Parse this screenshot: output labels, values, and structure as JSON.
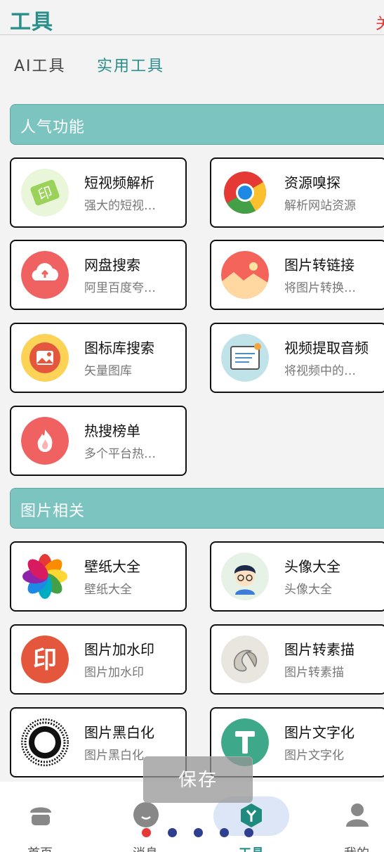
{
  "header": {
    "title": "工具",
    "right_text": "关"
  },
  "tabs": [
    {
      "label": "AI工具"
    },
    {
      "label": "实用工具"
    }
  ],
  "sections": [
    {
      "title": "人气功能",
      "items": [
        {
          "title": "短视频解析",
          "subtitle": "强大的短视…",
          "icon": "video-parse-icon"
        },
        {
          "title": "资源嗅探",
          "subtitle": "解析网站资源",
          "icon": "chrome-icon"
        },
        {
          "title": "网盘搜索",
          "subtitle": "阿里百度夸…",
          "icon": "cloud-upload-icon"
        },
        {
          "title": "图片转链接",
          "subtitle": "将图片转换…",
          "icon": "landscape-icon"
        },
        {
          "title": "图标库搜索",
          "subtitle": "矢量图库",
          "icon": "image-library-icon"
        },
        {
          "title": "视频提取音频",
          "subtitle": "将视频中的…",
          "icon": "video-audio-icon"
        },
        {
          "title": "热搜榜单",
          "subtitle": "多个平台热…",
          "icon": "flame-icon"
        }
      ]
    },
    {
      "title": "图片相关",
      "items": [
        {
          "title": "壁纸大全",
          "subtitle": "壁纸大全",
          "icon": "flower-icon"
        },
        {
          "title": "头像大全",
          "subtitle": "头像大全",
          "icon": "avatar-boy-icon"
        },
        {
          "title": "图片加水印",
          "subtitle": "图片加水印",
          "icon": "stamp-icon"
        },
        {
          "title": "图片转素描",
          "subtitle": "图片转素描",
          "icon": "sketch-icon"
        },
        {
          "title": "图片黑白化",
          "subtitle": "图片黑白化",
          "icon": "halftone-circle-icon"
        },
        {
          "title": "图片文字化",
          "subtitle": "图片文字化",
          "icon": "text-t-icon"
        }
      ]
    }
  ],
  "toast": {
    "text": "保存"
  },
  "bottom_nav": [
    {
      "label": "首页",
      "icon": "home-icon"
    },
    {
      "label": "消息",
      "icon": "message-icon"
    },
    {
      "label": "工具",
      "icon": "tools-icon",
      "active": true
    },
    {
      "label": "我的",
      "icon": "profile-icon"
    }
  ],
  "page_indicator": {
    "count": 5,
    "active_index": 0
  },
  "colors": {
    "accent": "#2a8f8a",
    "section_bg": "#7cc4c0",
    "header_right": "#e53935",
    "dot_active": "#e53935",
    "dot_inactive": "#2f3f8f"
  }
}
